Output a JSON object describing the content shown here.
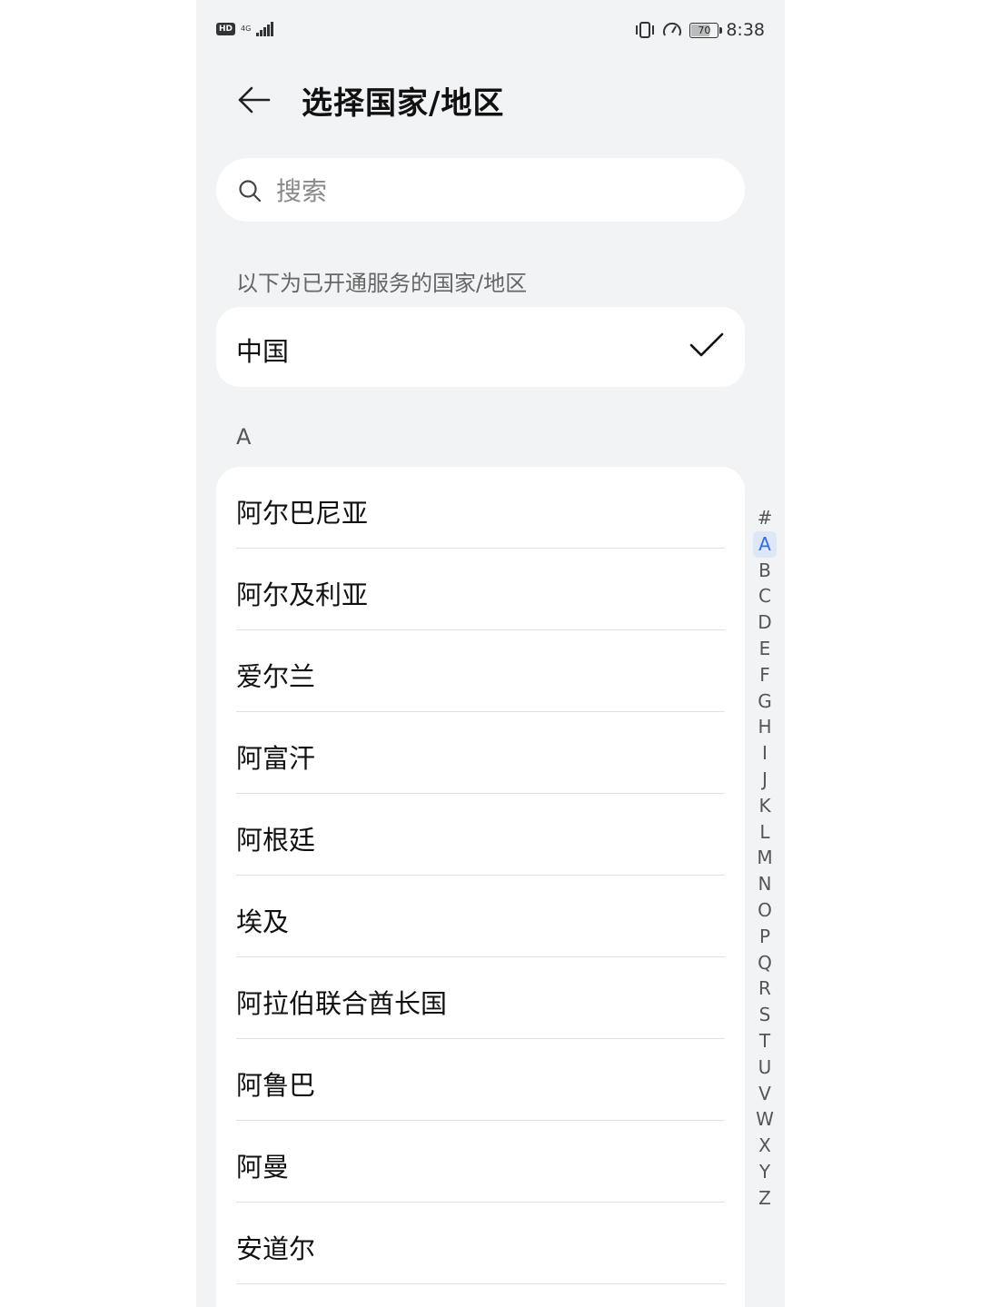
{
  "status_bar": {
    "hd_label": "HD",
    "network_label": "4G",
    "time": "8:38",
    "battery_level": "70",
    "battery_fraction": 0.7
  },
  "header": {
    "back_icon": "arrow-left-icon",
    "title": "选择国家/地区"
  },
  "search": {
    "icon": "search-icon",
    "placeholder": "搜索",
    "value": ""
  },
  "service_note": "以下为已开通服务的国家/地区",
  "selected_country": {
    "name": "中国",
    "icon": "checkmark-icon"
  },
  "section_letter": "A",
  "countries": [
    "阿尔巴尼亚",
    "阿尔及利亚",
    "爱尔兰",
    "阿富汗",
    "阿根廷",
    "埃及",
    "阿拉伯联合酋长国",
    "阿鲁巴",
    "阿曼",
    "安道尔"
  ],
  "alphabet_index": [
    "#",
    "A",
    "B",
    "C",
    "D",
    "E",
    "F",
    "G",
    "H",
    "I",
    "J",
    "K",
    "L",
    "M",
    "N",
    "O",
    "P",
    "Q",
    "R",
    "S",
    "T",
    "U",
    "V",
    "W",
    "X",
    "Y",
    "Z"
  ],
  "alphabet_active": "A",
  "colors": {
    "accent": "#2f6fe6",
    "background": "#f1f3f5",
    "card": "#ffffff"
  }
}
